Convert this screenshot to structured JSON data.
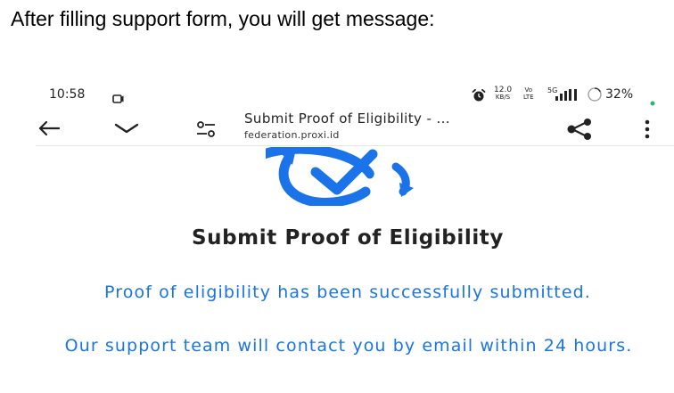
{
  "caption": "After filling support form, you will get message:",
  "status_bar": {
    "time": "10:58",
    "net_speed_value": "12.0",
    "net_speed_unit": "KB/S",
    "volte_top": "Vo",
    "volte_bottom": "LTE",
    "network_type": "5G",
    "battery": "32%"
  },
  "browser": {
    "page_title": "Submit Proof of Eligibility - ...",
    "domain": "federation.proxi.id"
  },
  "page": {
    "heading": "Submit Proof of Eligibility",
    "message_1": "Proof of eligibility has been successfully submitted.",
    "message_2": "Our support team will contact you by email within 24 hours."
  },
  "colors": {
    "accent_blue": "#1b74e4",
    "logo_blue": "#1a73e8",
    "battery_dot": "#2bb673"
  },
  "icons": {
    "back": "arrow-left-icon",
    "collapse": "chevron-down-icon",
    "tune": "page-controls-icon",
    "share": "share-icon",
    "menu": "more-vert-icon",
    "logo": "check-circle-refresh-icon"
  }
}
